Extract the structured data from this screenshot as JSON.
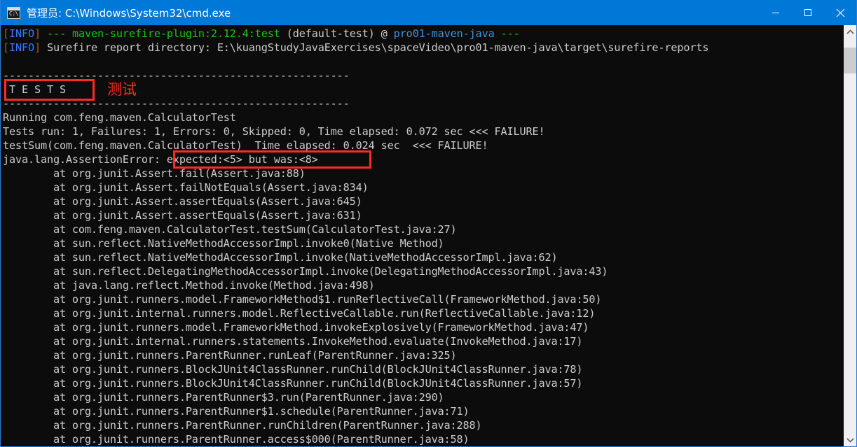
{
  "window": {
    "title": "管理员: C:\\Windows\\System32\\cmd.exe",
    "icon_name": "cmd-icon",
    "icon_glyph": "C:\\",
    "titlebar_color": "#0078d7",
    "console_bg": "#0c0c0c",
    "controls": {
      "minimize_label": "Minimize",
      "maximize_label": "Maximize",
      "close_label": "Close"
    }
  },
  "console": {
    "lines": [
      {
        "id": "l1",
        "segments": [
          {
            "text": "[",
            "color": "bracket"
          },
          {
            "text": "INFO",
            "color": "blue"
          },
          {
            "text": "] ",
            "color": "bracket"
          },
          {
            "text": "--- ",
            "color": "green"
          },
          {
            "text": "maven-surefire-plugin:2.12.4:test",
            "color": "green"
          },
          {
            "text": " (default-test) ",
            "color": "grey"
          },
          {
            "text": "@ ",
            "color": "grey"
          },
          {
            "text": "pro01-maven-java",
            "color": "cyan"
          },
          {
            "text": " ",
            "color": "grey"
          },
          {
            "text": "---",
            "color": "green"
          }
        ]
      },
      {
        "id": "l2",
        "segments": [
          {
            "text": "[",
            "color": "bracket"
          },
          {
            "text": "INFO",
            "color": "blue"
          },
          {
            "text": "] ",
            "color": "bracket"
          },
          {
            "text": "Surefire report directory: E:\\kuangStudyJavaExercises\\spaceVideo\\pro01-maven-java\\target\\surefire-reports",
            "color": "grey"
          }
        ]
      },
      {
        "id": "l3",
        "segments": [
          {
            "text": "",
            "color": "grey"
          }
        ]
      },
      {
        "id": "l4",
        "segments": [
          {
            "text": "-------------------------------------------------------",
            "color": "grey"
          }
        ]
      },
      {
        "id": "l5",
        "segments": [
          {
            "text": " T E S T S",
            "color": "grey"
          }
        ]
      },
      {
        "id": "l6",
        "segments": [
          {
            "text": "-------------------------------------------------------",
            "color": "grey"
          }
        ]
      },
      {
        "id": "l7",
        "segments": [
          {
            "text": "Running com.feng.maven.CalculatorTest",
            "color": "grey"
          }
        ]
      },
      {
        "id": "l8",
        "segments": [
          {
            "text": "Tests run: 1, Failures: 1, Errors: 0, Skipped: 0, Time elapsed: 0.072 sec <<< FAILURE!",
            "color": "grey"
          }
        ]
      },
      {
        "id": "l9",
        "segments": [
          {
            "text": "testSum(com.feng.maven.CalculatorTest)  Time elapsed: 0.024 sec  <<< FAILURE!",
            "color": "grey"
          }
        ]
      },
      {
        "id": "l10",
        "segments": [
          {
            "text": "java.lang.AssertionError: expected:<5> but was:<8>",
            "color": "grey"
          }
        ]
      },
      {
        "id": "l11",
        "segments": [
          {
            "text": "        at org.junit.Assert.fail(Assert.java:88)",
            "color": "grey"
          }
        ]
      },
      {
        "id": "l12",
        "segments": [
          {
            "text": "        at org.junit.Assert.failNotEquals(Assert.java:834)",
            "color": "grey"
          }
        ]
      },
      {
        "id": "l13",
        "segments": [
          {
            "text": "        at org.junit.Assert.assertEquals(Assert.java:645)",
            "color": "grey"
          }
        ]
      },
      {
        "id": "l14",
        "segments": [
          {
            "text": "        at org.junit.Assert.assertEquals(Assert.java:631)",
            "color": "grey"
          }
        ]
      },
      {
        "id": "l15",
        "segments": [
          {
            "text": "        at com.feng.maven.CalculatorTest.testSum(CalculatorTest.java:27)",
            "color": "grey"
          }
        ]
      },
      {
        "id": "l16",
        "segments": [
          {
            "text": "        at sun.reflect.NativeMethodAccessorImpl.invoke0(Native Method)",
            "color": "grey"
          }
        ]
      },
      {
        "id": "l17",
        "segments": [
          {
            "text": "        at sun.reflect.NativeMethodAccessorImpl.invoke(NativeMethodAccessorImpl.java:62)",
            "color": "grey"
          }
        ]
      },
      {
        "id": "l18",
        "segments": [
          {
            "text": "        at sun.reflect.DelegatingMethodAccessorImpl.invoke(DelegatingMethodAccessorImpl.java:43)",
            "color": "grey"
          }
        ]
      },
      {
        "id": "l19",
        "segments": [
          {
            "text": "        at java.lang.reflect.Method.invoke(Method.java:498)",
            "color": "grey"
          }
        ]
      },
      {
        "id": "l20",
        "segments": [
          {
            "text": "        at org.junit.runners.model.FrameworkMethod$1.runReflectiveCall(FrameworkMethod.java:50)",
            "color": "grey"
          }
        ]
      },
      {
        "id": "l21",
        "segments": [
          {
            "text": "        at org.junit.internal.runners.model.ReflectiveCallable.run(ReflectiveCallable.java:12)",
            "color": "grey"
          }
        ]
      },
      {
        "id": "l22",
        "segments": [
          {
            "text": "        at org.junit.runners.model.FrameworkMethod.invokeExplosively(FrameworkMethod.java:47)",
            "color": "grey"
          }
        ]
      },
      {
        "id": "l23",
        "segments": [
          {
            "text": "        at org.junit.internal.runners.statements.InvokeMethod.evaluate(InvokeMethod.java:17)",
            "color": "grey"
          }
        ]
      },
      {
        "id": "l24",
        "segments": [
          {
            "text": "        at org.junit.runners.ParentRunner.runLeaf(ParentRunner.java:325)",
            "color": "grey"
          }
        ]
      },
      {
        "id": "l25",
        "segments": [
          {
            "text": "        at org.junit.runners.BlockJUnit4ClassRunner.runChild(BlockJUnit4ClassRunner.java:78)",
            "color": "grey"
          }
        ]
      },
      {
        "id": "l26",
        "segments": [
          {
            "text": "        at org.junit.runners.BlockJUnit4ClassRunner.runChild(BlockJUnit4ClassRunner.java:57)",
            "color": "grey"
          }
        ]
      },
      {
        "id": "l27",
        "segments": [
          {
            "text": "        at org.junit.runners.ParentRunner$3.run(ParentRunner.java:290)",
            "color": "grey"
          }
        ]
      },
      {
        "id": "l28",
        "segments": [
          {
            "text": "        at org.junit.runners.ParentRunner$1.schedule(ParentRunner.java:71)",
            "color": "grey"
          }
        ]
      },
      {
        "id": "l29",
        "segments": [
          {
            "text": "        at org.junit.runners.ParentRunner.runChildren(ParentRunner.java:288)",
            "color": "grey"
          }
        ]
      },
      {
        "id": "l30",
        "segments": [
          {
            "text": "        at org.junit.runners.ParentRunner.access$000(ParentRunner.java:58)",
            "color": "grey"
          }
        ]
      }
    ]
  },
  "annotations": {
    "color": "#ff2a22",
    "tests_box_label": "T E S T S",
    "tests_caption": "测试",
    "expected_box_label": "expected:<5> but was:<8>"
  },
  "scrollbar": {
    "up_arrow_name": "scroll-up-arrow",
    "down_arrow_name": "scroll-down-arrow",
    "thumb_name": "scroll-thumb"
  }
}
